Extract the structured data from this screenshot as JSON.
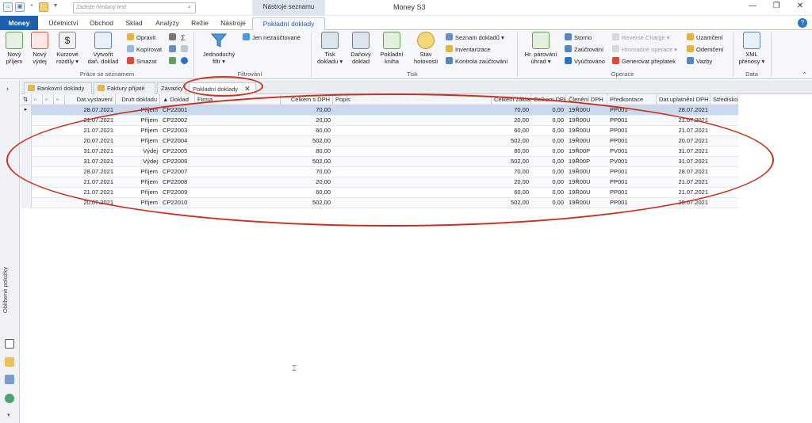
{
  "titlebar": {
    "search_placeholder": "Zadejte hledaný text",
    "context_title": "Nástroje seznamu",
    "app_title": "Money S3"
  },
  "ribbon_tabs": [
    "Money",
    "Účetnictví",
    "Obchod",
    "Sklad",
    "Analýzy",
    "Režie",
    "Nástroje",
    "Pokladní doklady"
  ],
  "ribbon": {
    "nova_prijem": "Nový\npříjem",
    "novy_vydej": "Nový\nvýdej",
    "kurzove": "Kurzové\nrozdíly ▾",
    "vytvorit": "Vytvořit\ndaň. doklad",
    "opravit": "Opravit",
    "kopirovat": "Kopírovat",
    "smazat": "Smazat",
    "grp_prace": "Práce se seznamem",
    "jednoduchy": "Jednoduchý\nfiltr ▾",
    "jen_nezauct": "Jen nezaúčtované",
    "grp_filtrovani": "Filtrování",
    "tisk_dokladu": "Tisk\ndokladu ▾",
    "danovy": "Daňový\ndoklad",
    "pokladni_kniha": "Pokladní\nkniha",
    "stav": "Stav\nhotovosti",
    "seznam_dokladu": "Seznam dokladů ▾",
    "inventarizace": "Inventarizace",
    "kontrola": "Kontrola zaúčtování",
    "grp_tisk": "Tisk",
    "hr_parovani": "Hr. párování\núhrad ▾",
    "storno": "Storno",
    "zauctovani": "Zaúčtování",
    "vyuctovano": "Vyúčtováno",
    "reverse": "Reverse Charge ▾",
    "hromadne": "Hromadné operace ▾",
    "generovat": "Generovat přeplatek",
    "uzamceni": "Uzamčení",
    "odemceni": "Odemčení",
    "vazby": "Vazby",
    "grp_operace": "Operace",
    "xml": "XML\npřenosy ▾",
    "grp_data": "Data"
  },
  "sidebar": {
    "label": "Oblíbené položky"
  },
  "doc_tabs": [
    "Bankovní doklady",
    "Faktury přijaté",
    "Závazky",
    "Pokladní doklady"
  ],
  "columns": [
    "Dat.vystavení",
    "Druh dokladu",
    "Doklad",
    "Firma",
    "Celkem s DPH",
    "Popis",
    "Celkem základ",
    "Celkem DPH",
    "Členění DPH",
    "Předkontace",
    "Dat.uplatnění DPH",
    "Středisko"
  ],
  "rows": [
    [
      "28.07.2021",
      "Příjem",
      "CP22001",
      "",
      "70,00",
      "",
      "70,00",
      "0,00",
      "19Ř00U",
      "PP001",
      "28.07.2021",
      ""
    ],
    [
      "21.07.2021",
      "Příjem",
      "CP22002",
      "",
      "20,00",
      "",
      "20,00",
      "0,00",
      "19Ř00U",
      "PP001",
      "21.07.2021",
      ""
    ],
    [
      "21.07.2021",
      "Příjem",
      "CP22003",
      "",
      "60,00",
      "",
      "60,00",
      "0,00",
      "19Ř00U",
      "PP001",
      "21.07.2021",
      ""
    ],
    [
      "20.07.2021",
      "Příjem",
      "CP22004",
      "",
      "502,00",
      "",
      "502,00",
      "0,00",
      "19Ř00U",
      "PP001",
      "20.07.2021",
      ""
    ],
    [
      "31.07.2021",
      "Výdej",
      "CP22005",
      "",
      "80,00",
      "",
      "80,00",
      "0,00",
      "19Ř00P",
      "PV001",
      "31.07.2021",
      ""
    ],
    [
      "31.07.2021",
      "Výdej",
      "CP22006",
      "",
      "502,00",
      "",
      "502,00",
      "0,00",
      "19Ř00P",
      "PV001",
      "31.07.2021",
      ""
    ],
    [
      "28.07.2021",
      "Příjem",
      "CP22007",
      "",
      "70,00",
      "",
      "70,00",
      "0,00",
      "19Ř00U",
      "PP001",
      "28.07.2021",
      ""
    ],
    [
      "21.07.2021",
      "Příjem",
      "CP22008",
      "",
      "20,00",
      "",
      "20,00",
      "0,00",
      "19Ř00U",
      "PP001",
      "21.07.2021",
      ""
    ],
    [
      "21.07.2021",
      "Příjem",
      "CP22009",
      "",
      "60,00",
      "",
      "60,00",
      "0,00",
      "19Ř00U",
      "PP001",
      "21.07.2021",
      ""
    ],
    [
      "20.07.2021",
      "Příjem",
      "CP22010",
      "",
      "502,00",
      "",
      "502,00",
      "0,00",
      "19Ř00U",
      "PP001",
      "20.07.2021",
      ""
    ]
  ],
  "colors": {
    "money_tab": "#1f5fae",
    "selected_row": "#c9d9ee",
    "annotation": "#c8321e"
  }
}
